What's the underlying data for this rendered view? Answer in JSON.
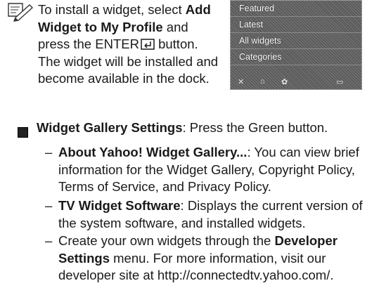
{
  "note": {
    "icon": "pencil-note-icon",
    "prefix": "To install a widget, select ",
    "bold": "Add Widget to My Profile",
    "mid": " and press the ",
    "enter": "ENTER",
    "suffix": " button. The widget will be installed and become available in the dock."
  },
  "panel": {
    "items": [
      "Featured",
      "Latest",
      "All widgets",
      "Categories"
    ]
  },
  "settings": {
    "title": "Widget Gallery Settings",
    "desc": ": Press the Green button.",
    "subitems": [
      {
        "bold": "About Yahoo! Widget Gallery...",
        "text": ": You can view brief information for the Widget Gallery, Copyright Policy, Terms of Service, and Privacy Policy."
      },
      {
        "bold": "TV Widget Software",
        "text": ": Displays the current version of the system software, and installed widgets."
      },
      {
        "pre": "Create your own widgets through the ",
        "bold": "Developer Settings",
        "text": " menu. For more information, visit our developer site at http://connectedtv.yahoo.com/."
      }
    ]
  }
}
